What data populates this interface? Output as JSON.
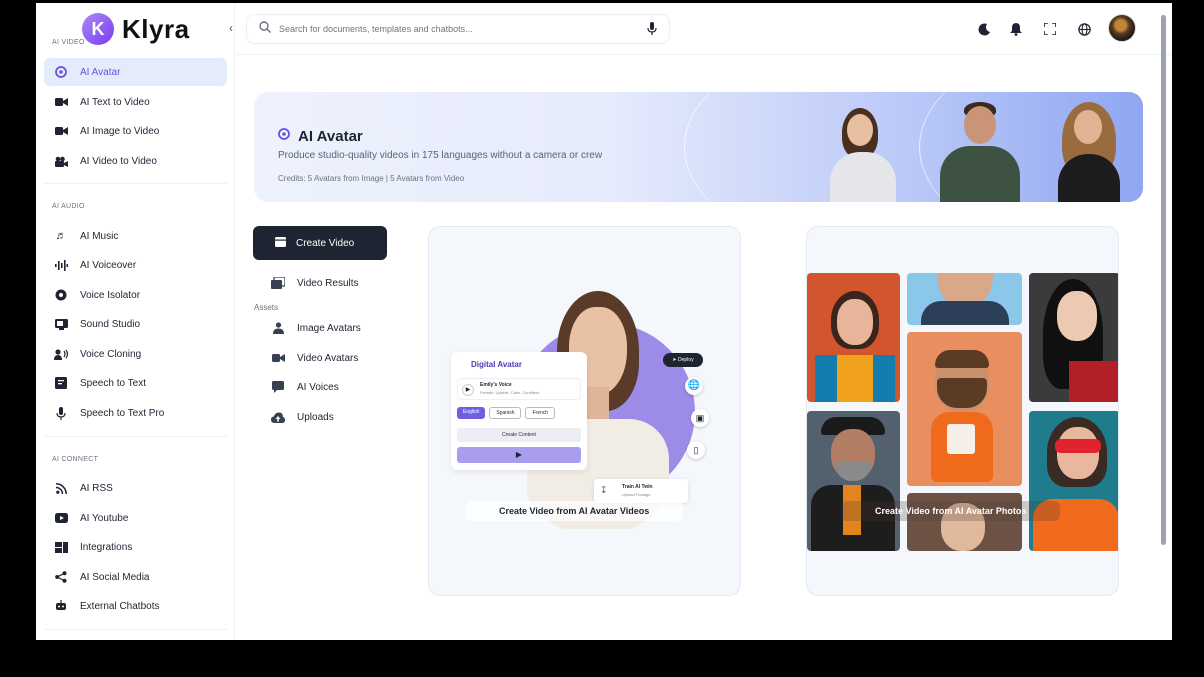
{
  "app": {
    "name": "Klyra",
    "logo_letter": "K",
    "accent": "#6d4fe0"
  },
  "sidebar": {
    "sections": [
      {
        "label": "AI VIDEO",
        "items": [
          {
            "label": "AI Avatar",
            "icon": "avatar-icon",
            "active": true
          },
          {
            "label": "AI Text to Video",
            "icon": "video-camera-icon"
          },
          {
            "label": "AI Image to Video",
            "icon": "video-camera-icon"
          },
          {
            "label": "AI Video to Video",
            "icon": "film-camera-icon"
          }
        ]
      },
      {
        "label": "AI AUDIO",
        "items": [
          {
            "label": "AI Music",
            "icon": "music-icon"
          },
          {
            "label": "AI Voiceover",
            "icon": "waveform-icon"
          },
          {
            "label": "Voice Isolator",
            "icon": "record-icon"
          },
          {
            "label": "Sound Studio",
            "icon": "studio-icon"
          },
          {
            "label": "Voice Cloning",
            "icon": "voice-clone-icon"
          },
          {
            "label": "Speech to Text",
            "icon": "transcript-icon"
          },
          {
            "label": "Speech to Text Pro",
            "icon": "microphone-icon"
          }
        ]
      },
      {
        "label": "AI CONNECT",
        "items": [
          {
            "label": "AI RSS",
            "icon": "rss-icon"
          },
          {
            "label": "AI Youtube",
            "icon": "youtube-icon"
          },
          {
            "label": "Integrations",
            "icon": "integrations-icon"
          },
          {
            "label": "AI Social Media",
            "icon": "share-icon"
          },
          {
            "label": "External Chatbots",
            "icon": "chatbot-icon"
          }
        ]
      }
    ]
  },
  "search": {
    "placeholder": "Search for documents, templates and chatbots..."
  },
  "hero": {
    "title": "AI Avatar",
    "subtitle": "Produce studio-quality videos in 175 languages without a camera or crew",
    "credits": "Credits: 5 Avatars from Image | 5 Avatars from Video"
  },
  "menu": {
    "create_video": "Create Video",
    "video_results": "Video Results",
    "assets_label": "Assets",
    "assets": [
      "Image Avatars",
      "Video Avatars",
      "AI Voices",
      "Uploads"
    ]
  },
  "cards": [
    {
      "caption": "Create Video from AI Avatar Videos",
      "mockup": {
        "title": "Digital Avatar",
        "voice_name": "Emily's Voice",
        "voice_desc": "Female, Upbeat, Calm, Confident",
        "languages": [
          "English",
          "Spanish",
          "French"
        ],
        "button": "Create Content",
        "deploy": "Deploy",
        "train_title": "Train AI Twin",
        "train_sub": "Upload Footage"
      }
    },
    {
      "caption": "Create Video from AI Avatar Photos"
    }
  ]
}
